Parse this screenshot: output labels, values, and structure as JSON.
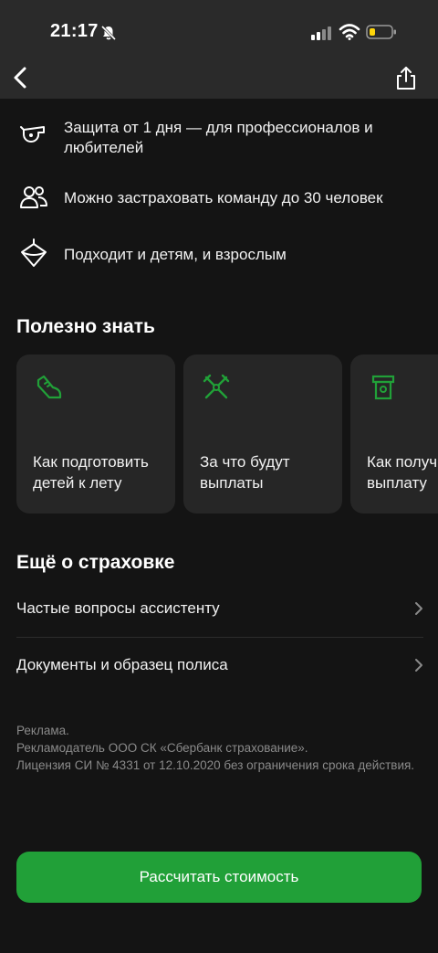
{
  "status_bar": {
    "time": "21:17",
    "icons": [
      "bell-slash-icon",
      "signal-icon",
      "wifi-icon",
      "battery-icon"
    ]
  },
  "nav": {
    "back_icon": "chevron-left-icon",
    "share_icon": "share-icon"
  },
  "features": [
    {
      "icon": "whistle-icon",
      "text": "Защита от 1 дня — для профессионалов и любителей"
    },
    {
      "icon": "people-icon",
      "text": "Можно застраховать команду до 30 человек"
    },
    {
      "icon": "spinning-top-icon",
      "text": "Подходит и детям, и взрослым"
    }
  ],
  "useful": {
    "title": "Полезно знать",
    "cards": [
      {
        "icon": "sneaker-icon",
        "label": "Как подготовить\nдетей к лету"
      },
      {
        "icon": "crossed-sticks-icon",
        "label": "За что будут\nвыплаты"
      },
      {
        "icon": "atm-icon",
        "label": "Как получить\nвыплату"
      }
    ]
  },
  "more": {
    "title": "Ещё о страховке",
    "items": [
      {
        "label": "Частые вопросы ассистенту"
      },
      {
        "label": "Документы и образец полиса"
      }
    ]
  },
  "disclaimer": {
    "line1": "Реклама.",
    "line2": "Рекламодатель ООО СК «Сбербанк страхование».",
    "line3": "Лицензия СИ № 4331 от 12.10.2020 без ограничения срока действия."
  },
  "cta": {
    "label": "Рассчитать стоимость"
  },
  "colors": {
    "accent": "#21a038",
    "background": "#141414",
    "card": "#262626"
  }
}
